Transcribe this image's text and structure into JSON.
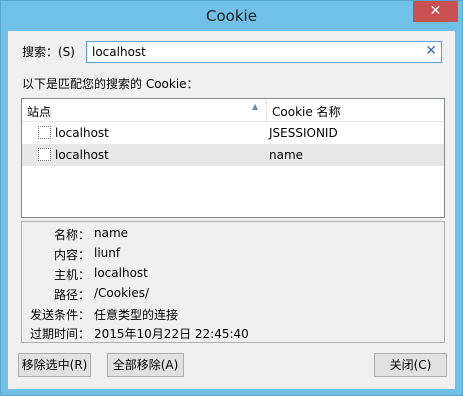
{
  "window": {
    "title": "Cookie",
    "close_glyph": "✕"
  },
  "search": {
    "label": "搜索：(S)",
    "value": "localhost",
    "clear_glyph": "✕"
  },
  "description": "以下是匹配您的搜索的 Cookie：",
  "table": {
    "col_site": "站点",
    "col_name": "Cookie 名称",
    "rows": [
      {
        "site": "localhost",
        "name": "JSESSIONID"
      },
      {
        "site": "localhost",
        "name": "name"
      }
    ]
  },
  "details": {
    "name_label": "名称：",
    "name_value": "name",
    "content_label": "内容：",
    "content_value": "liunf",
    "host_label": "主机：",
    "host_value": "localhost",
    "path_label": "路径：",
    "path_value": "/Cookies/",
    "send_label": "发送条件：",
    "send_value": "任意类型的连接",
    "expires_label": "过期时间：",
    "expires_value": "2015年10月22日 22:45:40"
  },
  "buttons": {
    "remove_selected": "移除选中(R)",
    "remove_all": "全部移除(A)",
    "close": "关闭(C)"
  }
}
